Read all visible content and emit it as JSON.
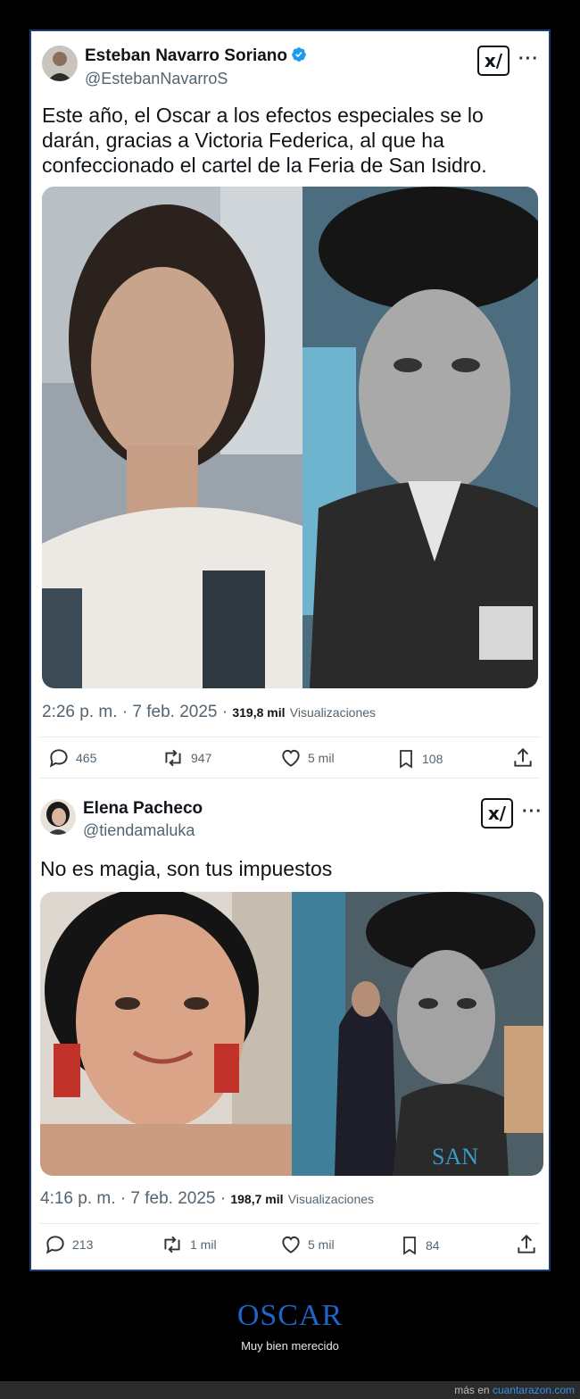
{
  "tweets": [
    {
      "name": "Esteban Navarro Soriano",
      "handle": "@EstebanNavarroS",
      "text": "Este año, el Oscar a los efectos especiales se lo darán, gracias a Victoria Federica, al que ha confeccionado el cartel de la Feria de San Isidro.",
      "time": "2:26 p. m. · 7 feb. 2025 ·",
      "views": "319,8 mil",
      "views_label": "Visualizaciones",
      "replies": "465",
      "retweets": "947",
      "likes": "5 mil",
      "bookmarks": "108"
    },
    {
      "name": "Elena Pacheco",
      "handle": "@tiendamaluka",
      "text": "No es magia, son tus impuestos",
      "time": "4:16 p. m. · 7 feb. 2025 ·",
      "views": "198,7 mil",
      "views_label": "Visualizaciones",
      "replies": "213",
      "retweets": "1 mil",
      "likes": "5 mil",
      "bookmarks": "84"
    }
  ],
  "grok_label": "x/",
  "more_label": "···",
  "footer": {
    "title": "OSCAR",
    "subtitle": "Muy bien merecido",
    "more_prefix": "más en",
    "site": "cuantarazon.com"
  },
  "colors": {
    "verified": "#1d9bf0",
    "card_border": "#1d3a78",
    "footer_title": "#1f64c8",
    "link": "#3a8ee6"
  }
}
